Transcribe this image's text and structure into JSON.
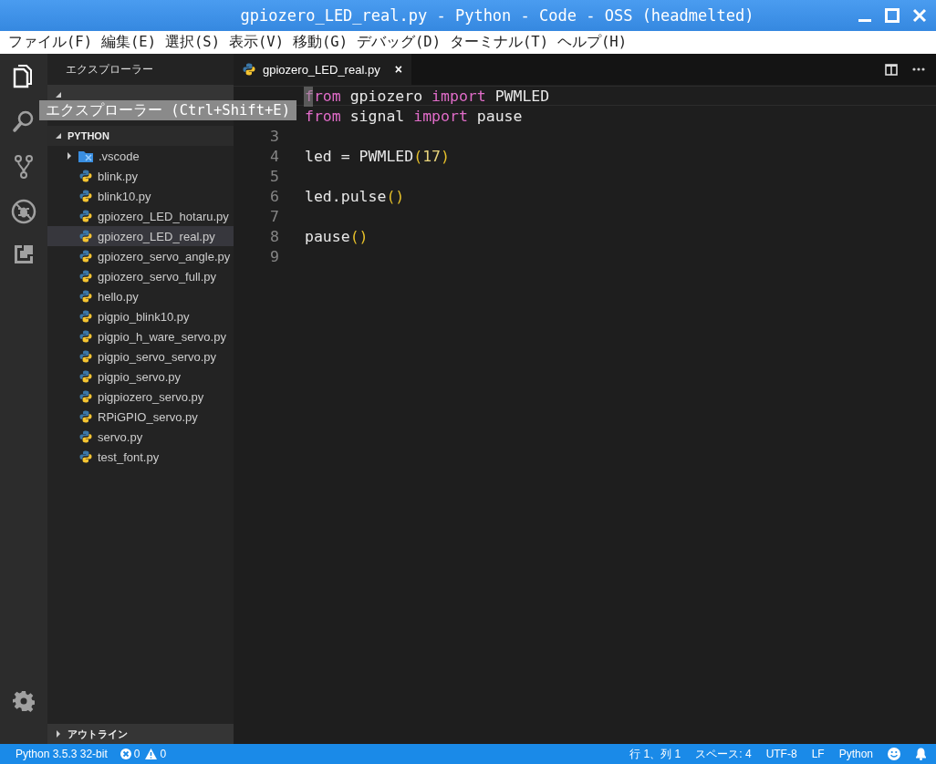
{
  "window": {
    "title": "gpiozero_LED_real.py - Python - Code - OSS (headmelted)"
  },
  "menu": [
    "ファイル(F)",
    "編集(E)",
    "選択(S)",
    "表示(V)",
    "移動(G)",
    "デバッグ(D)",
    "ターミナル(T)",
    "ヘルプ(H)"
  ],
  "activity_bar": [
    {
      "kind": "explorer",
      "selected": true
    },
    {
      "kind": "search",
      "selected": false
    },
    {
      "kind": "source-control",
      "selected": false
    },
    {
      "kind": "debug",
      "selected": false
    },
    {
      "kind": "extensions",
      "selected": false
    },
    {
      "kind": "settings",
      "selected": false
    }
  ],
  "sidebar": {
    "title": "エクスプローラー",
    "open_editors": {
      "expanded": true
    },
    "folder": {
      "label": "PYTHON",
      "expanded": true,
      "items": [
        {
          "name": ".vscode",
          "kind": "folder",
          "expanded": false,
          "selected": false
        },
        {
          "name": "blink.py",
          "kind": "python",
          "selected": false
        },
        {
          "name": "blink10.py",
          "kind": "python",
          "selected": false
        },
        {
          "name": "gpiozero_LED_hotaru.py",
          "kind": "python",
          "selected": false
        },
        {
          "name": "gpiozero_LED_real.py",
          "kind": "python",
          "selected": true
        },
        {
          "name": "gpiozero_servo_angle.py",
          "kind": "python",
          "selected": false
        },
        {
          "name": "gpiozero_servo_full.py",
          "kind": "python",
          "selected": false
        },
        {
          "name": "hello.py",
          "kind": "python",
          "selected": false
        },
        {
          "name": "pigpio_blink10.py",
          "kind": "python",
          "selected": false
        },
        {
          "name": "pigpio_h_ware_servo.py",
          "kind": "python",
          "selected": false
        },
        {
          "name": "pigpio_servo_servo.py",
          "kind": "python",
          "selected": false
        },
        {
          "name": "pigpio_servo.py",
          "kind": "python",
          "selected": false
        },
        {
          "name": "pigpiozero_servo.py",
          "kind": "python",
          "selected": false
        },
        {
          "name": "RPiGPIO_servo.py",
          "kind": "python",
          "selected": false
        },
        {
          "name": "servo.py",
          "kind": "python",
          "selected": false
        },
        {
          "name": "test_font.py",
          "kind": "python",
          "selected": false
        }
      ]
    },
    "outline": {
      "label": "アウトライン",
      "expanded": false
    }
  },
  "tabs": [
    {
      "label": "gpiozero_LED_real.py",
      "selected": true,
      "close": "×"
    }
  ],
  "editor": {
    "lines": [
      {
        "current": true,
        "tokens": [
          {
            "kind": "keyword",
            "text": "from"
          },
          {
            "kind": "plain",
            "text": " gpiozero "
          },
          {
            "kind": "keyword",
            "text": "import"
          },
          {
            "kind": "plain",
            "text": " PWMLED"
          }
        ]
      },
      {
        "current": false,
        "tokens": [
          {
            "kind": "keyword",
            "text": "from"
          },
          {
            "kind": "plain",
            "text": " signal "
          },
          {
            "kind": "keyword",
            "text": "import"
          },
          {
            "kind": "plain",
            "text": " pause"
          }
        ]
      },
      {
        "number": "3",
        "current": false
      },
      {
        "number": "4",
        "current": false,
        "tokens": [
          {
            "kind": "plain",
            "text": "led = PWMLED"
          },
          {
            "kind": "paren",
            "text": "("
          },
          {
            "kind": "number",
            "text": "17"
          },
          {
            "kind": "paren",
            "text": ")"
          }
        ]
      },
      {
        "number": "5",
        "current": false
      },
      {
        "number": "6",
        "current": false,
        "tokens": [
          {
            "kind": "plain",
            "text": "led.pulse"
          },
          {
            "kind": "paren",
            "text": "()"
          }
        ]
      },
      {
        "number": "7",
        "current": false
      },
      {
        "number": "8",
        "current": false,
        "tokens": [
          {
            "kind": "plain",
            "text": "pause"
          },
          {
            "kind": "paren",
            "text": "()"
          }
        ]
      },
      {
        "number": "9",
        "current": false
      }
    ]
  },
  "tooltip": {
    "text": "エクスプローラー (Ctrl+Shift+E)"
  },
  "status_bar": {
    "interpreter": "Python 3.5.3 32-bit",
    "errors": "0",
    "warnings": "0",
    "position": "行 1、列 1",
    "indent": "スペース: 4",
    "encoding": "UTF-8",
    "eol": "LF",
    "language": "Python"
  }
}
